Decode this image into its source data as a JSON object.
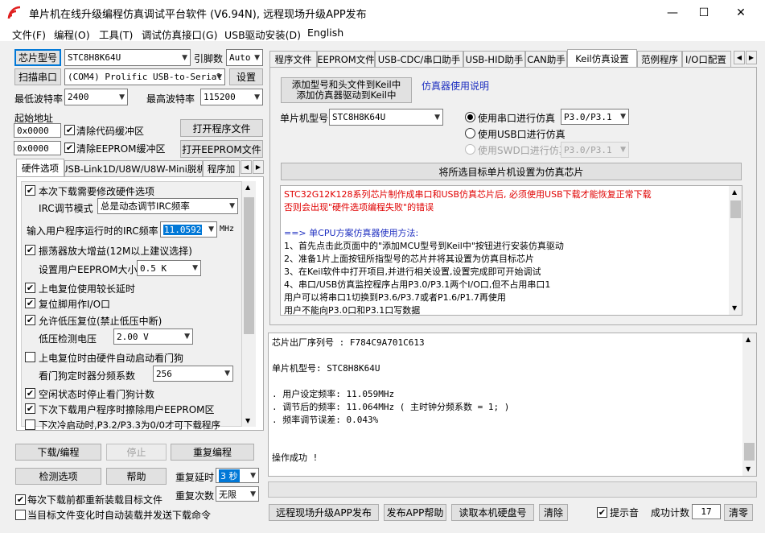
{
  "window": {
    "title": "单片机在线升级编程仿真调试平台软件 (V6.94N), 远程现场升级APP发布",
    "minimize": "—",
    "maximize": "☐",
    "close": "✕"
  },
  "menu": [
    "文件(F)",
    "编程(O)",
    "工具(T)",
    "调试仿真接口(G)",
    "USB驱动安装(D)",
    "English"
  ],
  "left": {
    "chip_model_button": "芯片型号",
    "chip_model_value": "STC8H8K64U",
    "pin_count_label": "引脚数",
    "pin_count_value": "Auto",
    "scan_port_button": "扫描串口",
    "port_value": "(COM4) Prolific USB-to-Serial",
    "settings_button": "设置",
    "min_baud_label": "最低波特率",
    "min_baud_value": "2400",
    "max_baud_label": "最高波特率",
    "max_baud_value": "115200",
    "start_addr_label": "起始地址",
    "addr1_value": "0x0000",
    "clear_code_label": "清除代码缓冲区",
    "open_prog_button": "打开程序文件",
    "addr2_value": "0x0000",
    "clear_eeprom_label": "清除EEPROM缓冲区",
    "open_eeprom_button": "打开EEPROM文件",
    "tabs": [
      "硬件选项",
      "USB-Link1D/U8W/U8W-Mini脱机",
      "程序加"
    ],
    "hw": {
      "opt_modify_label": "本次下载需要修改硬件选项",
      "irc_mode_label": "IRC调节模式",
      "irc_mode_value": "总是动态调节IRC频率",
      "irc_freq_label": "输入用户程序运行时的IRC频率",
      "irc_freq_value": "11.0592",
      "irc_freq_unit": "MHz",
      "osc_gain_label": "振荡器放大增益(12M以上建议选择)",
      "eeprom_size_label": "设置用户EEPROM大小",
      "eeprom_size_value": "0.5 K",
      "power_delay_label": "上电复位使用较长延时",
      "reset_pin_label": "复位脚用作I/O口",
      "low_volt_reset_label": "允许低压复位(禁止低压中断)",
      "low_volt_detect_label": "低压检测电压",
      "low_volt_value": "2.00 V",
      "wdt_start_label": "上电复位时由硬件自动启动看门狗",
      "wdt_div_label": "看门狗定时器分频系数",
      "wdt_div_value": "256",
      "idle_stop_wdt_label": "空闲状态时停止看门狗计数",
      "erase_eeprom_label": "下次下载用户程序时擦除用户EEPROM区",
      "cold_start_label": "下次冷启动时,P3.2/P3.3为0/0才可下载程序"
    },
    "download_button": "下载/编程",
    "stop_button": "停止",
    "reprogram_button": "重复编程",
    "detect_button": "检测选项",
    "help_button": "帮助",
    "repeat_delay_label": "重复延时",
    "repeat_delay_value": "3 秒",
    "repeat_count_label": "重复次数",
    "repeat_count_value": "无限",
    "reload_label": "每次下载前都重新装载目标文件",
    "auto_load_label": "当目标文件变化时自动装载并发送下载命令"
  },
  "right": {
    "tabs": [
      "程序文件",
      "EEPROM文件",
      "USB-CDC/串口助手",
      "USB-HID助手",
      "CAN助手",
      "Keil仿真设置",
      "范例程序",
      "I/O口配置"
    ],
    "add_to_keil_button_line1": "添加型号和头文件到Keil中",
    "add_to_keil_button_line2": "添加仿真器驱动到Keil中",
    "emulator_help_link": "仿真器使用说明",
    "mcu_model_label": "单片机型号",
    "mcu_model_value": "STC8H8K64U",
    "radio_serial_label": "使用串口进行仿真",
    "radio_serial_port": "P3.0/P3.1",
    "radio_usb_label": "使用USB口进行仿真",
    "radio_swd_label": "使用SWD口进行仿真",
    "radio_swd_port": "P3.0/P3.1",
    "set_emulator_button": "将所选目标单片机设置为仿真芯片",
    "info_lines": [
      {
        "text": "STC32G12K128系列芯片制作成串口和USB仿真芯片后, 必须使用USB下载才能恢复正常下载",
        "color": "red"
      },
      {
        "text": "否则会出现\"硬件选项编程失败\"的错误",
        "color": "red"
      },
      {
        "text": "",
        "color": "black"
      },
      {
        "text": "  ==> 单CPU方案仿真器使用方法:",
        "color": "blue"
      },
      {
        "text": "1、首先点击此页面中的\"添加MCU型号到Keil中\"按钮进行安装仿真驱动",
        "color": "black"
      },
      {
        "text": "2、准备1片上面按钮所指型号的芯片并将其设置为仿真目标芯片",
        "color": "black"
      },
      {
        "text": "3、在Keil软件中打开项目,并进行相关设置,设置完成即可开始调试",
        "color": "black"
      },
      {
        "text": "4、串口/USB仿真监控程序占用P3.0/P3.1两个I/O口,但不占用串口1",
        "color": "black"
      },
      {
        "text": "   用户可以将串口1切换到P3.6/P3.7或者P1.6/P1.7再使用",
        "color": "black"
      },
      {
        "text": "   用户不能向P3.0口和P3.1口写数据",
        "color": "black"
      }
    ],
    "log_lines": [
      "芯片出厂序列号 : F784C9A701C613",
      "",
      "  单片机型号: STC8H8K64U",
      "",
      "  . 用户设定频率: 11.059MHz",
      "  . 调节后的频率: 11.064MHz ( 主时钟分频系数 = 1; )",
      "  . 频率调节误差: 0.043%",
      "",
      "",
      "",
      "操作成功 !"
    ],
    "remote_upgrade_button": "远程现场升级APP发布",
    "publish_help_button": "发布APP帮助",
    "read_disk_button": "读取本机硬盘号",
    "clear_button": "清除",
    "beep_label": "提示音",
    "success_count_label": "成功计数",
    "success_count_value": "17",
    "clear_count_button": "清零"
  }
}
